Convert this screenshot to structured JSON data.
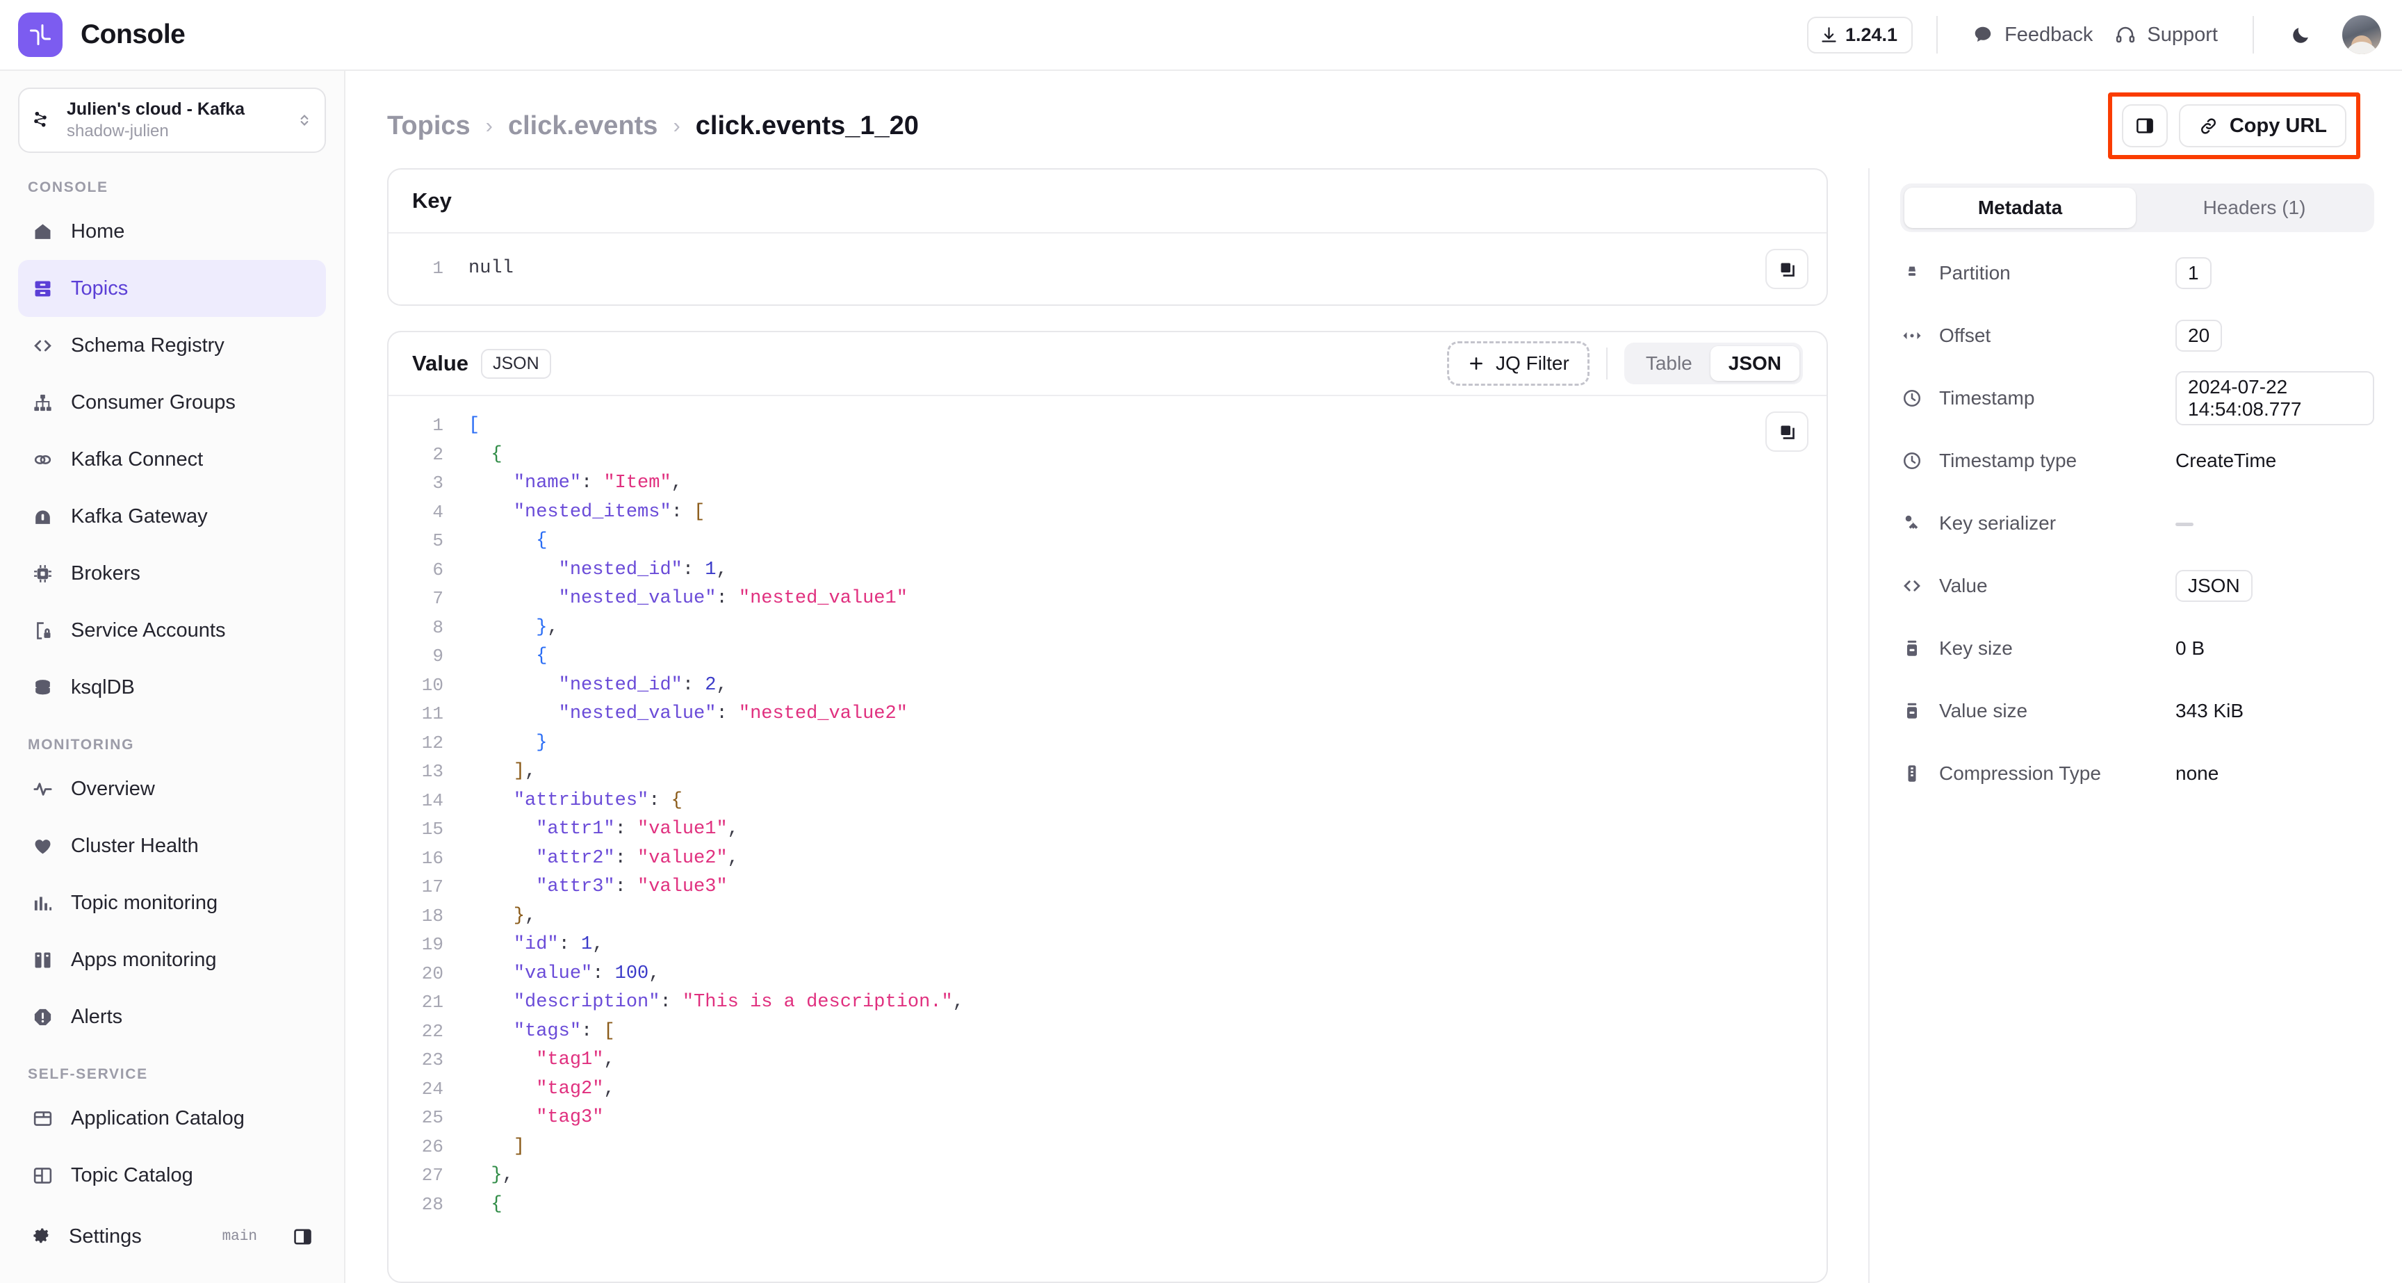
{
  "topbar": {
    "brand": "Console",
    "version": "1.24.1",
    "feedback": "Feedback",
    "support": "Support"
  },
  "sidebar": {
    "cluster": {
      "name": "Julien's cloud - Kafka",
      "sub": "shadow-julien"
    },
    "sections": [
      {
        "title": "CONSOLE"
      },
      {
        "title": "MONITORING"
      },
      {
        "title": "SELF-SERVICE"
      }
    ],
    "console_items": [
      {
        "label": "Home",
        "icon": "home-icon",
        "active": false
      },
      {
        "label": "Topics",
        "icon": "topics-icon",
        "active": true
      },
      {
        "label": "Schema Registry",
        "icon": "code-brackets-icon",
        "active": false
      },
      {
        "label": "Consumer Groups",
        "icon": "hierarchy-icon",
        "active": false
      },
      {
        "label": "Kafka Connect",
        "icon": "link-chain-icon",
        "active": false
      },
      {
        "label": "Kafka Gateway",
        "icon": "gateway-icon",
        "active": false
      },
      {
        "label": "Brokers",
        "icon": "chip-icon",
        "active": false
      },
      {
        "label": "Service Accounts",
        "icon": "file-lock-icon",
        "active": false
      },
      {
        "label": "ksqlDB",
        "icon": "database-icon",
        "active": false
      }
    ],
    "monitoring_items": [
      {
        "label": "Overview",
        "icon": "activity-pulse-icon"
      },
      {
        "label": "Cluster Health",
        "icon": "heart-icon"
      },
      {
        "label": "Topic monitoring",
        "icon": "bar-chart-icon"
      },
      {
        "label": "Apps monitoring",
        "icon": "apps-icon"
      },
      {
        "label": "Alerts",
        "icon": "alert-circle-icon"
      }
    ],
    "selfservice_items": [
      {
        "label": "Application Catalog",
        "icon": "window-icon"
      },
      {
        "label": "Topic Catalog",
        "icon": "layout-icon"
      }
    ],
    "settings": {
      "label": "Settings",
      "branch": "main"
    }
  },
  "breadcrumb": {
    "root": "Topics",
    "parent": "click.events",
    "current": "click.events_1_20",
    "separator": "›"
  },
  "actions": {
    "copy_url": "Copy URL"
  },
  "key_panel": {
    "title": "Key",
    "lines": [
      {
        "n": "1",
        "text": "null",
        "cls": "t-p"
      }
    ]
  },
  "value_panel": {
    "title": "Value",
    "format_badge": "JSON",
    "jq_filter": "JQ Filter",
    "view_table": "Table",
    "view_json": "JSON",
    "selected_view": "JSON",
    "lines": [
      {
        "n": "1",
        "html": "<span class='t-b1'>[</span>"
      },
      {
        "n": "2",
        "html": "  <span class='t-b2'>{</span>"
      },
      {
        "n": "3",
        "html": "    <span class='t-key'>\"name\"</span><span class='t-p'>: </span><span class='t-str'>\"Item\"</span><span class='t-p'>,</span>"
      },
      {
        "n": "4",
        "html": "    <span class='t-key'>\"nested_items\"</span><span class='t-p'>: </span><span class='t-b3'>[</span>"
      },
      {
        "n": "5",
        "html": "      <span class='t-b1'>{</span>"
      },
      {
        "n": "6",
        "html": "        <span class='t-key'>\"nested_id\"</span><span class='t-p'>: </span><span class='t-num'>1</span><span class='t-p'>,</span>"
      },
      {
        "n": "7",
        "html": "        <span class='t-key'>\"nested_value\"</span><span class='t-p'>: </span><span class='t-str'>\"nested_value1\"</span>"
      },
      {
        "n": "8",
        "html": "      <span class='t-b1'>}</span><span class='t-p'>,</span>"
      },
      {
        "n": "9",
        "html": "      <span class='t-b1'>{</span>"
      },
      {
        "n": "10",
        "html": "        <span class='t-key'>\"nested_id\"</span><span class='t-p'>: </span><span class='t-num'>2</span><span class='t-p'>,</span>"
      },
      {
        "n": "11",
        "html": "        <span class='t-key'>\"nested_value\"</span><span class='t-p'>: </span><span class='t-str'>\"nested_value2\"</span>"
      },
      {
        "n": "12",
        "html": "      <span class='t-b1'>}</span>"
      },
      {
        "n": "13",
        "html": "    <span class='t-b3'>]</span><span class='t-p'>,</span>"
      },
      {
        "n": "14",
        "html": "    <span class='t-key'>\"attributes\"</span><span class='t-p'>: </span><span class='t-b3'>{</span>"
      },
      {
        "n": "15",
        "html": "      <span class='t-key'>\"attr1\"</span><span class='t-p'>: </span><span class='t-str'>\"value1\"</span><span class='t-p'>,</span>"
      },
      {
        "n": "16",
        "html": "      <span class='t-key'>\"attr2\"</span><span class='t-p'>: </span><span class='t-str'>\"value2\"</span><span class='t-p'>,</span>"
      },
      {
        "n": "17",
        "html": "      <span class='t-key'>\"attr3\"</span><span class='t-p'>: </span><span class='t-str'>\"value3\"</span>"
      },
      {
        "n": "18",
        "html": "    <span class='t-b3'>}</span><span class='t-p'>,</span>"
      },
      {
        "n": "19",
        "html": "    <span class='t-key'>\"id\"</span><span class='t-p'>: </span><span class='t-num'>1</span><span class='t-p'>,</span>"
      },
      {
        "n": "20",
        "html": "    <span class='t-key'>\"value\"</span><span class='t-p'>: </span><span class='t-num'>100</span><span class='t-p'>,</span>"
      },
      {
        "n": "21",
        "html": "    <span class='t-key'>\"description\"</span><span class='t-p'>: </span><span class='t-str'>\"This is a description.\"</span><span class='t-p'>,</span>"
      },
      {
        "n": "22",
        "html": "    <span class='t-key'>\"tags\"</span><span class='t-p'>: </span><span class='t-b3'>[</span>"
      },
      {
        "n": "23",
        "html": "      <span class='t-str'>\"tag1\"</span><span class='t-p'>,</span>"
      },
      {
        "n": "24",
        "html": "      <span class='t-str'>\"tag2\"</span><span class='t-p'>,</span>"
      },
      {
        "n": "25",
        "html": "      <span class='t-str'>\"tag3\"</span>"
      },
      {
        "n": "26",
        "html": "    <span class='t-b3'>]</span>"
      },
      {
        "n": "27",
        "html": "  <span class='t-b2'>}</span><span class='t-p'>,</span>"
      },
      {
        "n": "28",
        "html": "  <span class='t-b2'>{</span>"
      }
    ]
  },
  "metadata_panel": {
    "tabs": [
      {
        "label": "Metadata",
        "active": true
      },
      {
        "label": "Headers (1)",
        "active": false
      }
    ],
    "rows": [
      {
        "icon": "partition-icon",
        "label": "Partition",
        "value": "1",
        "boxed": true
      },
      {
        "icon": "offset-icon",
        "label": "Offset",
        "value": "20",
        "boxed": true
      },
      {
        "icon": "clock-icon",
        "label": "Timestamp",
        "value": "2024-07-22 14:54:08.777",
        "boxed": true
      },
      {
        "icon": "clock-icon",
        "label": "Timestamp type",
        "value": "CreateTime",
        "boxed": false
      },
      {
        "icon": "key-icon",
        "label": "Key serializer",
        "value": "",
        "boxed": false,
        "dash": true
      },
      {
        "icon": "code-brackets-icon",
        "label": "Value",
        "value": "JSON",
        "boxed": true
      },
      {
        "icon": "size-icon",
        "label": "Key size",
        "value": "0 B",
        "boxed": false
      },
      {
        "icon": "size-icon",
        "label": "Value size",
        "value": "343 KiB",
        "boxed": false
      },
      {
        "icon": "compression-icon",
        "label": "Compression Type",
        "value": "none",
        "boxed": false
      }
    ]
  },
  "colors": {
    "accent": "#5b3fd6",
    "accent_bg": "#eeecfd",
    "logo_bg": "#7c5cf0",
    "annotation": "#fa3c00",
    "json_key": "#6a4bd8",
    "json_string": "#e0307f",
    "json_number": "#3b3bc9"
  }
}
